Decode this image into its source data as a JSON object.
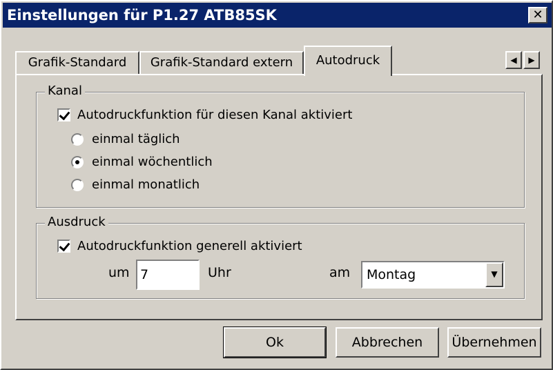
{
  "window": {
    "title": "Einstellungen für P1.27 ATB85SK",
    "close_glyph": "✕"
  },
  "tabs": [
    {
      "label": "Grafik-Standard",
      "active": false
    },
    {
      "label": "Grafik-Standard extern",
      "active": false
    },
    {
      "label": "Autodruck",
      "active": true
    }
  ],
  "tab_scroll": {
    "left": "◀",
    "right": "▶"
  },
  "kanal": {
    "label": "Kanal",
    "checkbox_label": "Autodruckfunktion für diesen Kanal aktiviert",
    "checkbox_checked": true,
    "options": [
      {
        "label": "einmal täglich",
        "checked": false
      },
      {
        "label": "einmal wöchentlich",
        "checked": true
      },
      {
        "label": "einmal monatlich",
        "checked": false
      }
    ]
  },
  "ausdruck": {
    "label": "Ausdruck",
    "checkbox_label": "Autodruckfunktion generell aktiviert",
    "checkbox_checked": true,
    "um_label": "um",
    "hour_value": "7",
    "uhr_label": "Uhr",
    "am_label": "am",
    "day_value": "Montag",
    "dropdown_glyph": "▼"
  },
  "buttons": {
    "ok": "Ok",
    "cancel": "Abbrechen",
    "apply": "Übernehmen"
  }
}
